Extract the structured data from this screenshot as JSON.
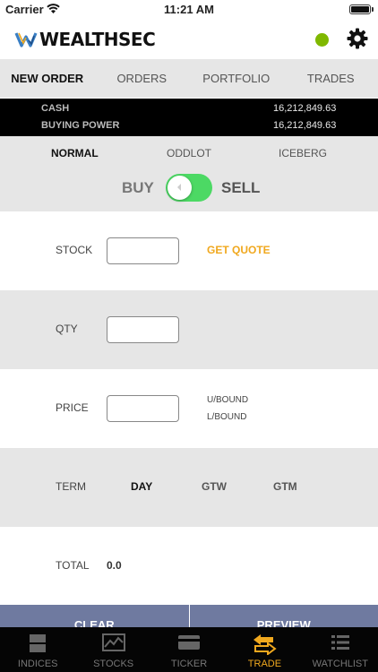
{
  "status_bar": {
    "carrier": "Carrier",
    "time": "11:21 AM"
  },
  "header": {
    "app_name": "WEALTHSEC",
    "connection_color": "#7fb800"
  },
  "main_tabs": [
    {
      "label": "NEW ORDER",
      "active": true
    },
    {
      "label": "ORDERS",
      "active": false
    },
    {
      "label": "PORTFOLIO",
      "active": false
    },
    {
      "label": "TRADES",
      "active": false
    }
  ],
  "account": {
    "cash_label": "CASH",
    "cash_value": "16,212,849.63",
    "buying_power_label": "BUYING POWER",
    "buying_power_value": "16,212,849.63"
  },
  "order_types": [
    {
      "label": "NORMAL",
      "active": true
    },
    {
      "label": "ODDLOT",
      "active": false
    },
    {
      "label": "ICEBERG",
      "active": false
    }
  ],
  "side": {
    "buy_label": "BUY",
    "sell_label": "SELL",
    "toggle_color": "#4cd964"
  },
  "form": {
    "stock_label": "STOCK",
    "stock_value": "",
    "get_quote_label": "GET QUOTE",
    "qty_label": "QTY",
    "qty_value": "",
    "price_label": "PRICE",
    "price_value": "",
    "upper_bound_label": "U/BOUND",
    "lower_bound_label": "L/BOUND",
    "term_label": "TERM",
    "term_options": [
      {
        "label": "DAY",
        "active": true
      },
      {
        "label": "GTW",
        "active": false
      },
      {
        "label": "GTM",
        "active": false
      }
    ],
    "total_label": "TOTAL",
    "total_value": "0.0"
  },
  "actions": {
    "clear_label": "CLEAR",
    "preview_label": "PREVIEW"
  },
  "bottom_nav": [
    {
      "label": "INDICES",
      "icon": "indices-icon",
      "active": false
    },
    {
      "label": "STOCKS",
      "icon": "stocks-chart-icon",
      "active": false
    },
    {
      "label": "TICKER",
      "icon": "ticker-card-icon",
      "active": false
    },
    {
      "label": "TRADE",
      "icon": "trade-arrows-icon",
      "active": true
    },
    {
      "label": "WATCHLIST",
      "icon": "watchlist-icon",
      "active": false
    }
  ],
  "colors": {
    "accent": "#f0a81e",
    "action_bar": "#6f7aa0"
  }
}
